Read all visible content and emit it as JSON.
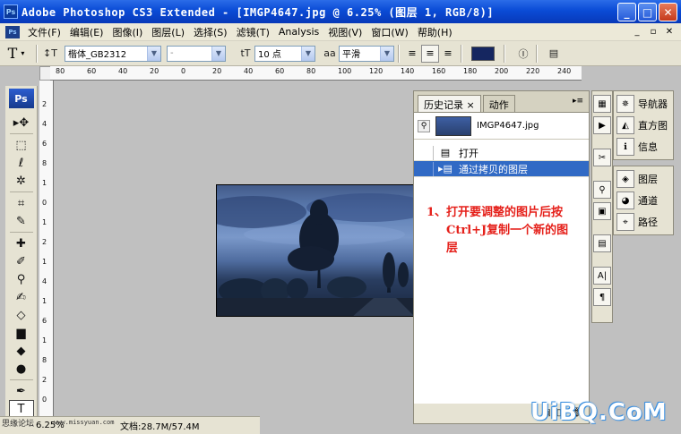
{
  "window": {
    "icon": "Ps",
    "title": "Adobe Photoshop CS3 Extended - [IMGP4647.jpg @ 6.25% (图层 1, RGB/8)]",
    "minimize": "_",
    "maximize": "□",
    "close": "✕"
  },
  "menu": {
    "items": [
      "文件(F)",
      "编辑(E)",
      "图像(I)",
      "图层(L)",
      "选择(S)",
      "滤镜(T)",
      "Analysis",
      "视图(V)",
      "窗口(W)",
      "帮助(H)"
    ],
    "mdi": [
      "_",
      "▫",
      "✕"
    ]
  },
  "options_bar": {
    "tool_icon": "T",
    "orient_icon": "↕T",
    "font_family": "楷体_GB2312",
    "font_style": "-",
    "size_icon": "tT",
    "font_size": "10 点",
    "aa_icon": "aa",
    "anti_alias": "平滑",
    "text_color": "#152660"
  },
  "rulers": {
    "h_ticks": [
      "80",
      "60",
      "40",
      "20",
      "0",
      "20",
      "40",
      "60",
      "80",
      "100",
      "120",
      "140",
      "160",
      "180",
      "200",
      "220",
      "240"
    ],
    "v_ticks": [
      "2",
      "4",
      "6",
      "8",
      "1",
      "0",
      "1",
      "2",
      "1",
      "4",
      "1",
      "6",
      "1",
      "8",
      "2",
      "0"
    ]
  },
  "toolbox": {
    "logo": "Ps",
    "tools": [
      "move",
      "marquee",
      "lasso",
      "magic-wand",
      "crop",
      "slice",
      "healing",
      "brush",
      "stamp",
      "history-brush",
      "eraser",
      "gradient",
      "blur",
      "dodge",
      "pen",
      "type",
      "path-select"
    ]
  },
  "history_panel": {
    "tab_history": "历史记录",
    "tab_history_close": "×",
    "tab_actions": "动作",
    "menu_arrow": "▸≡",
    "snapshot_name": "IMGP4647.jpg",
    "rows": [
      {
        "label": "打开",
        "selected": false
      },
      {
        "label": "通过拷贝的图层",
        "selected": true
      }
    ]
  },
  "annotation": {
    "line1": "1、打开要调整的图片后按",
    "line2": "Ctrl+J复制一个新的图",
    "line3": "层"
  },
  "right_panels": {
    "group1": [
      "导航器",
      "直方图",
      "信息"
    ],
    "group2": [
      "图层",
      "通道",
      "路径"
    ]
  },
  "status": {
    "zoom": "6.25%",
    "doc": "文档:28.7M/57.4M"
  },
  "watermarks": {
    "left": "思缘论坛",
    "url": "www.missyuan.com",
    "uibq": "UiBQ.CoM"
  }
}
